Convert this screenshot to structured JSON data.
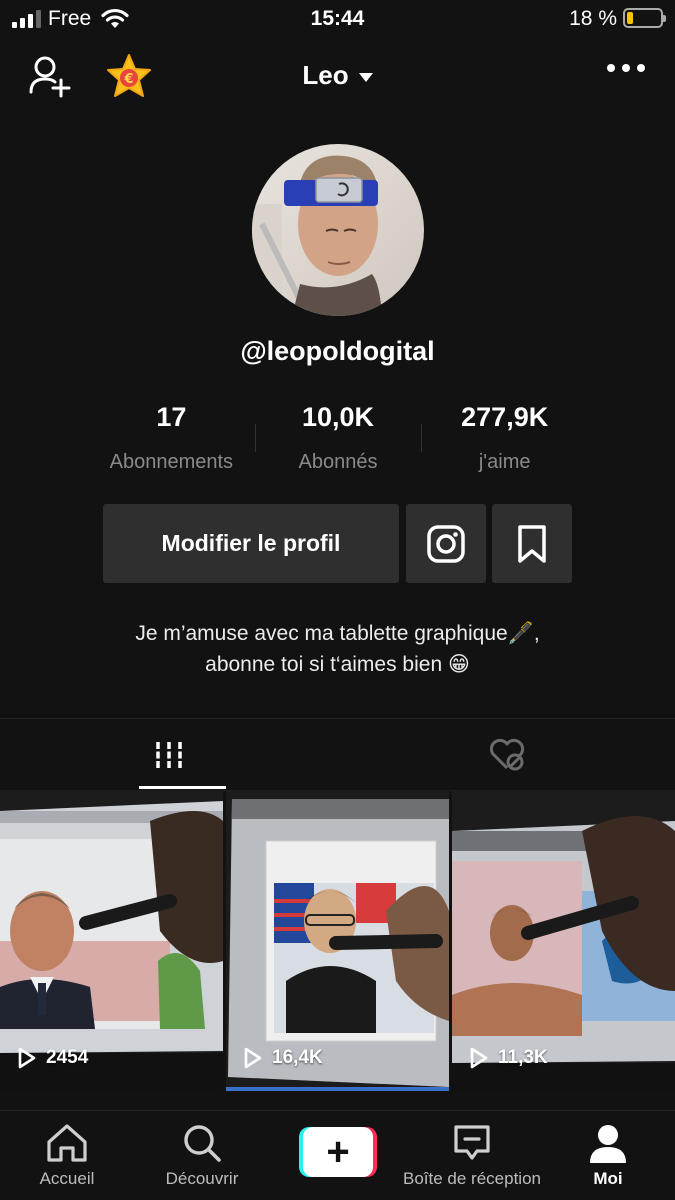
{
  "status_bar": {
    "carrier": "Free",
    "time": "15:44",
    "battery_percent": "18 %",
    "battery_level": 0.18,
    "battery_color": "#f5c400"
  },
  "header": {
    "title": "Leo",
    "left_icons": [
      "add-user-icon",
      "coin-star-icon"
    ],
    "right_icon": "more-icon"
  },
  "profile": {
    "username": "@leopoldogital",
    "stats": [
      {
        "value": "17",
        "label": "Abonnements"
      },
      {
        "value": "10,0K",
        "label": "Abonnés"
      },
      {
        "value": "277,9K",
        "label": "j'aime"
      }
    ],
    "edit_button": "Modifier le profil",
    "bio_line1": "Je m’amuse avec ma tablette graphique🖋️,",
    "bio_line2": "abonne toi si t‘aimes bien 😁"
  },
  "tabs": [
    {
      "icon": "grid-icon",
      "active": true
    },
    {
      "icon": "liked-hidden-icon",
      "active": false
    }
  ],
  "videos": [
    {
      "views": "2454"
    },
    {
      "views": "16,4K"
    },
    {
      "views": "11,3K"
    }
  ],
  "nav": {
    "items": [
      {
        "label": "Accueil",
        "icon": "home-icon"
      },
      {
        "label": "Découvrir",
        "icon": "search-icon"
      },
      {
        "label": "",
        "icon": "create-plus-icon"
      },
      {
        "label": "Boîte de réception",
        "icon": "inbox-icon"
      },
      {
        "label": "Moi",
        "icon": "profile-icon",
        "active": true
      }
    ]
  },
  "colors": {
    "background": "#121212",
    "button_bg": "#2f2f2f",
    "secondary_text": "#8a8a8a",
    "accent_cyan": "#25f4ee",
    "accent_red": "#fe2c55"
  }
}
